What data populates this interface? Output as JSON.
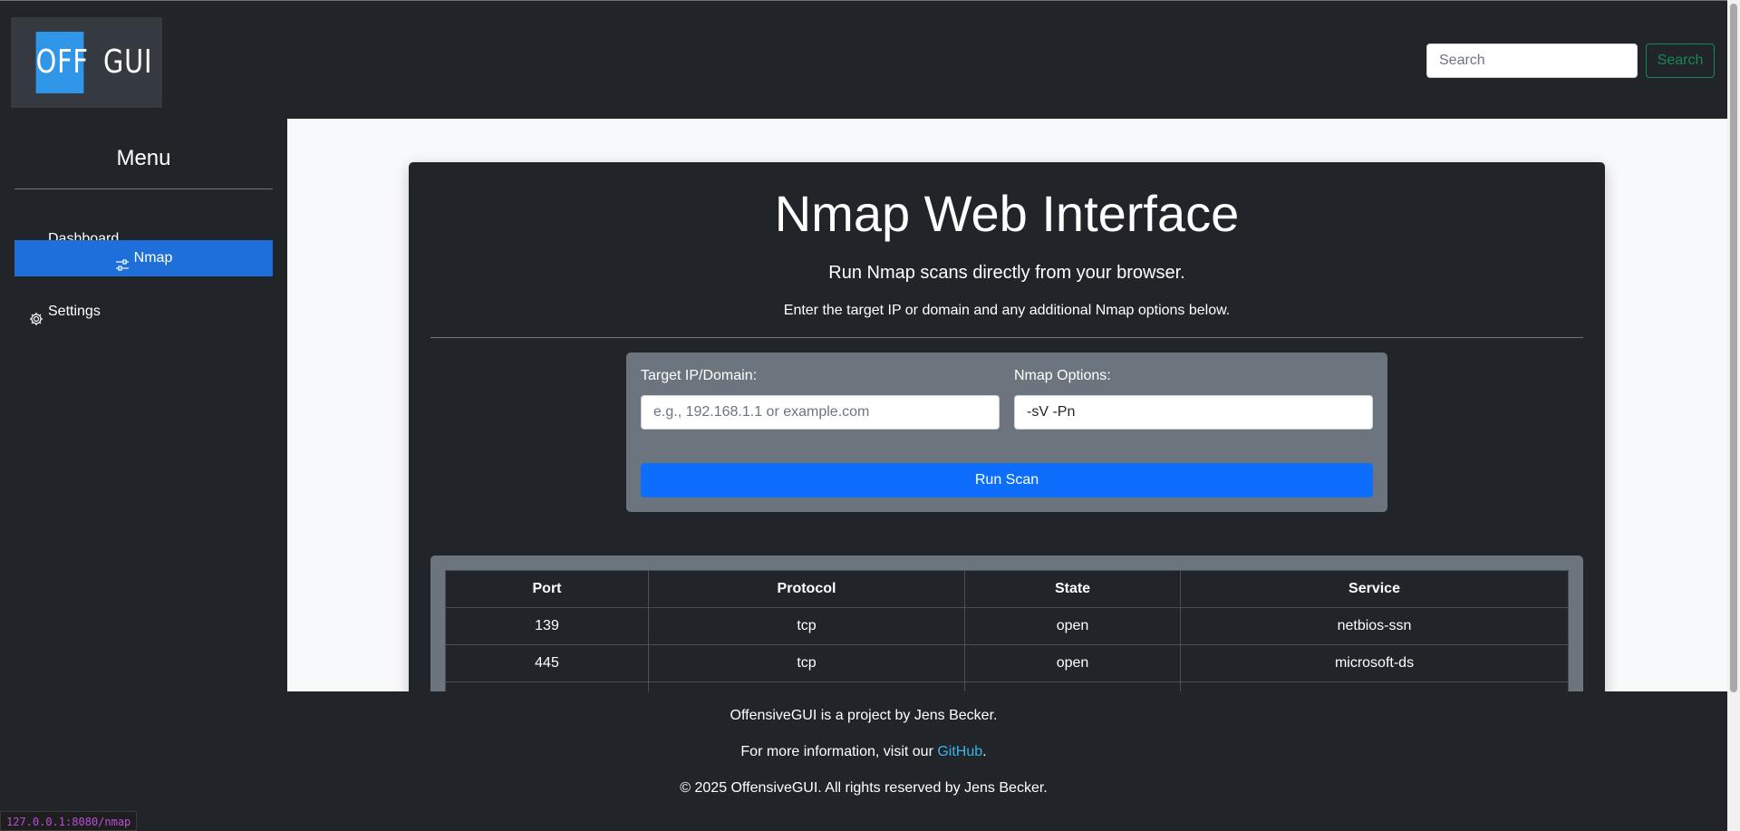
{
  "logo": {
    "left_text": "OFF",
    "right_text": "GUI"
  },
  "header": {
    "search_placeholder": "Search",
    "search_button": "Search"
  },
  "sidebar": {
    "title": "Menu",
    "items": [
      {
        "label": "Dashboard",
        "icon": "speedometer-icon",
        "active": false
      },
      {
        "label": "Nmap",
        "icon": "sliders-icon",
        "active": true
      },
      {
        "label": "Settings",
        "icon": "gear-icon",
        "active": false
      }
    ]
  },
  "main": {
    "title": "Nmap Web Interface",
    "subtitle": "Run Nmap scans directly from your browser.",
    "description": "Enter the target IP or domain and any additional Nmap options below.",
    "form": {
      "target_label": "Target IP/Domain:",
      "target_placeholder": "e.g., 192.168.1.1 or example.com",
      "options_label": "Nmap Options:",
      "options_value": "-sV -Pn",
      "run_button": "Run Scan"
    },
    "results": {
      "headers": [
        "Port",
        "Protocol",
        "State",
        "Service"
      ],
      "rows": [
        [
          "139",
          "tcp",
          "open",
          "netbios-ssn"
        ],
        [
          "445",
          "tcp",
          "open",
          "microsoft-ds"
        ]
      ]
    }
  },
  "footer": {
    "line1": "OffensiveGUI is a project by Jens Becker.",
    "line2_prefix": "For more information, visit our ",
    "line2_link": "GitHub",
    "line2_suffix": ".",
    "line3": "© 2025 OffensiveGUI. All rights reserved by Jens Becker."
  },
  "status_bar": {
    "url": "127.0.0.1:8080/nmap"
  },
  "colors": {
    "background": "#212529",
    "accent": "#1e6fd9",
    "button": "#0d6efd",
    "search_outline": "#198754",
    "link": "#3ab4e8"
  }
}
